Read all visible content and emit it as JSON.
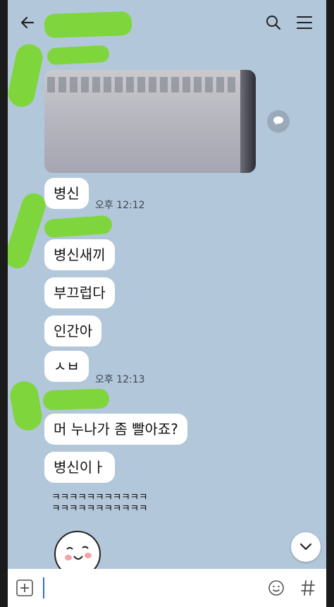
{
  "header": {
    "back_icon": "back-arrow-icon",
    "search_icon": "search-icon",
    "menu_icon": "menu-icon"
  },
  "messages": [
    {
      "text": "병신"
    },
    {
      "text": "병신새끼"
    },
    {
      "text": "부끄럽다"
    },
    {
      "text": "인간아"
    },
    {
      "text": "ㅅㅂ"
    },
    {
      "text": "머 누나가 좀 빨아죠?"
    },
    {
      "text": "병신이ㅏ"
    }
  ],
  "timestamps": [
    "오후 12:12",
    "오후 12:13"
  ],
  "laugh_lines": [
    "ㅋㅋㅋㅋㅋㅋㅋㅋㅋㅋㅋ",
    "ㅋㅋㅋㅋㅋㅋㅋㅋㅋㅋㅋ"
  ],
  "input": {
    "value": "",
    "plus_icon": "plus-icon",
    "emoji_icon": "emoji-icon",
    "hash_icon": "hashtag-icon"
  },
  "colors": {
    "chat_background": "#b2c7da",
    "bubble": "#ffffff",
    "redaction": "#7fd63c"
  }
}
